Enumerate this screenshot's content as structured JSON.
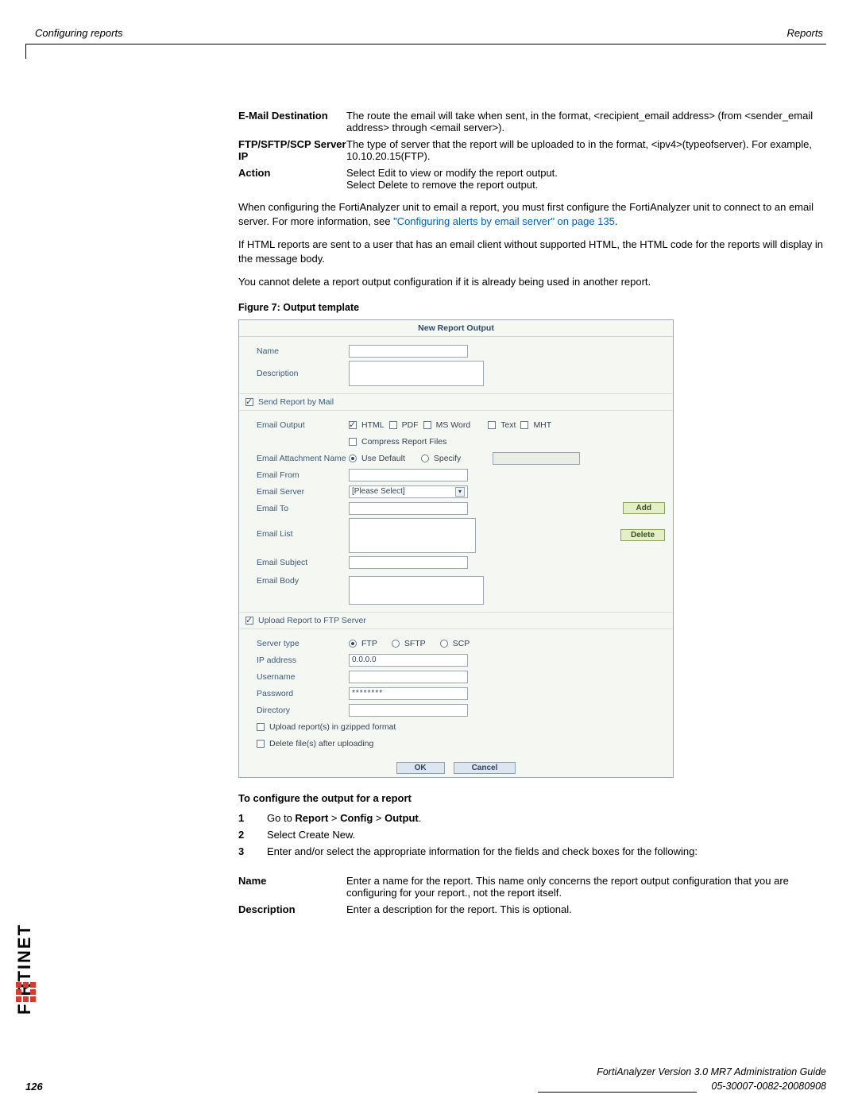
{
  "header": {
    "left": "Configuring reports",
    "right": "Reports"
  },
  "definitions": [
    {
      "term": "E-Mail Destination",
      "desc": "The route the email will take when sent, in the format, <recipient_email address> (from <sender_email address> through <email server>)."
    },
    {
      "term": "FTP/SFTP/SCP Server IP",
      "desc": "The type of server that the report will be uploaded to in the format, <ipv4>(typeofserver). For example, 10.10.20.15(FTP)."
    },
    {
      "term": "Action",
      "desc": "Select Edit to view or modify the report output.\nSelect Delete to remove the report output."
    }
  ],
  "paragraphs": {
    "p1a": "When configuring the FortiAnalyzer unit to email a report, you must first configure the FortiAnalyzer unit to connect to an email server. For more information, see ",
    "p1link": "\"Configuring alerts by email server\" on page 135",
    "p1b": ".",
    "p2": "If HTML reports are sent to a user that has an email client without supported HTML, the HTML code for the reports will display in the message body.",
    "p3": "You cannot delete a report output configuration if it is already being used in another report."
  },
  "figure": {
    "caption": "Figure 7:   Output template",
    "title": "New Report Output",
    "rows": {
      "name": "Name",
      "description": "Description",
      "sendmail": "Send Report by Mail",
      "emailoutput": "Email Output",
      "fmt_html": "HTML",
      "fmt_pdf": "PDF",
      "fmt_msw": "MS Word",
      "fmt_text": "Text",
      "fmt_mht": "MHT",
      "compress": "Compress Report Files",
      "attach": "Email Attachment Name",
      "usedefault": "Use Default",
      "specify": "Specify",
      "from": "Email From",
      "server": "Email Server",
      "server_sel": "[Please Select]",
      "to": "Email To",
      "add": "Add",
      "list": "Email List",
      "delete": "Delete",
      "subj": "Email Subject",
      "body": "Email Body",
      "uploadftp": "Upload Report to FTP Server",
      "stype": "Server type",
      "ftp": "FTP",
      "sftp": "SFTP",
      "scp": "SCP",
      "ip": "IP address",
      "ipval": "0.0.0.0",
      "user": "Username",
      "pass": "Password",
      "passval": "********",
      "dir": "Directory",
      "gz": "Upload report(s) in gzipped format",
      "delafter": "Delete file(s) after uploading",
      "ok": "OK",
      "cancel": "Cancel"
    }
  },
  "steps_title": "To configure the output for a report",
  "steps": [
    {
      "n": "1",
      "prefix": "Go to ",
      "b1": "Report",
      "sep": " > ",
      "b2": "Config",
      "b3": "Output",
      "suffix": "."
    },
    {
      "n": "2",
      "text": "Select Create New."
    },
    {
      "n": "3",
      "text": "Enter and/or select the appropriate information for the fields and check boxes for the following:"
    }
  ],
  "defs2": [
    {
      "term": "Name",
      "desc": "Enter a name for the report. This name only concerns the report output configuration that you are configuring for your report., not the report itself."
    },
    {
      "term": "Description",
      "desc": "Enter a description for the report. This is optional."
    }
  ],
  "footer": {
    "line1": "FortiAnalyzer Version 3.0 MR7 Administration Guide",
    "line2": "05-30007-0082-20080908",
    "pagenum": "126"
  },
  "logo_text": "F   RTINET"
}
